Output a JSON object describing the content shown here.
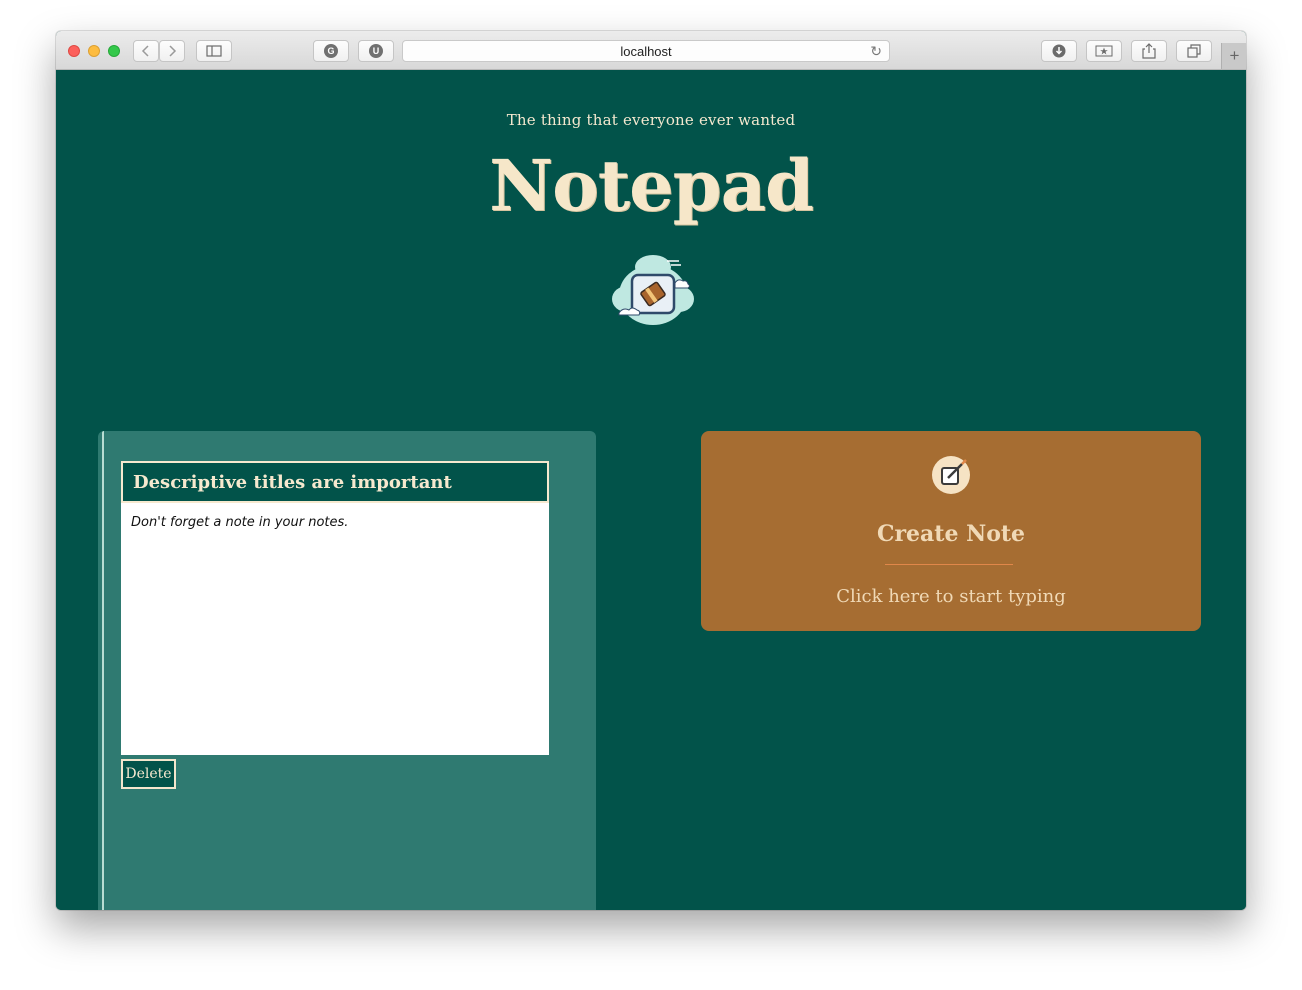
{
  "browser": {
    "url": "localhost"
  },
  "header": {
    "tagline": "The thing that everyone ever wanted",
    "title": "Notepad",
    "logo_icon": "notebook-cloud-icon"
  },
  "notes": [
    {
      "title": "Descriptive titles are important",
      "body": "Don't forget a note in your notes.",
      "delete_label": "Delete"
    }
  ],
  "create_card": {
    "icon": "edit-note-icon",
    "title": "Create Note",
    "subtitle": "Click here to start typing"
  },
  "colors": {
    "page_bg": "#02534a",
    "panel_bg": "#2f7a71",
    "card_bg": "#a66d32",
    "cream": "#f6e7c9",
    "accent": "#e0874a"
  }
}
